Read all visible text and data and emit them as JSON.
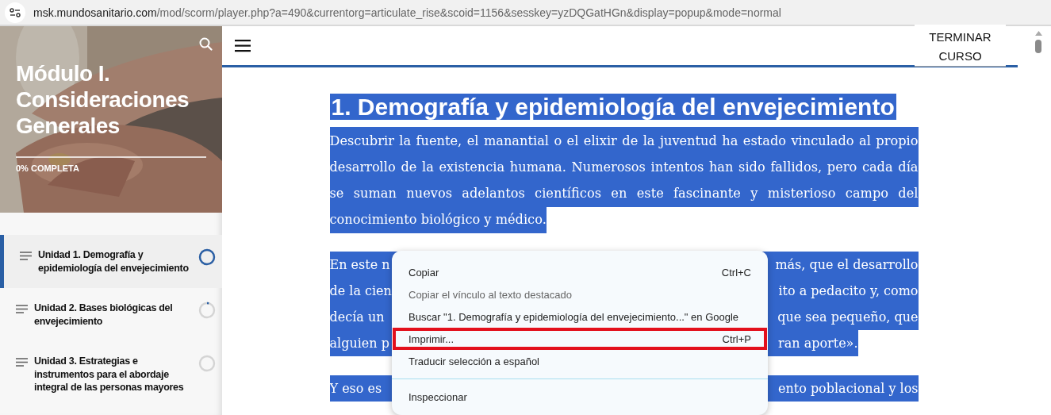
{
  "address_bar": {
    "domain": "msk.mundosanitario.com",
    "path": "/mod/scorm/player.php?a=490&currentorg=articulate_rise&scoid=1156&sesskey=yzDQGatHGn&display=popup&mode=normal"
  },
  "sidebar": {
    "title": "Módulo I. Consideraciones Generales",
    "progress": {
      "label": "0% COMPLETA",
      "level": 0
    },
    "items": [
      {
        "label": "Unidad 1. Demografía y epidemiología del envejecimiento",
        "selected": true,
        "level": 1
      },
      {
        "label": "Unidad 2. Bases biológicas del envejecimiento",
        "selected": false,
        "level": 0.04
      },
      {
        "label": "Unidad 3. Estrategias e instrumentos para el abordaje integral de las personas mayores",
        "selected": false,
        "level": 0
      }
    ]
  },
  "header": {
    "button": "TERMINAR CURSO"
  },
  "lesson": {
    "heading": "1. Demografía y epidemiología del envejecimiento",
    "paragraphs": [
      {
        "kind": "full",
        "text": "Descubrir la fuente, el manantial o el elixir de la juventud ha estado vinculado al propio desarrollo de la existencia humana. Numerosos intentos han sido fallidos, pero cada día se suman nuevos adelantos científicos en este fascinante y misterioso campo del conocimiento biológico y médico."
      },
      {
        "kind": "covered",
        "lines": [
          {
            "left": "En este n",
            "right": "más, que el desarrollo"
          },
          {
            "left": "de la cien",
            "right": "ito a pedacito y, como"
          },
          {
            "left": "decía un",
            "right": "que sea pequeño, que"
          },
          {
            "left": "alguien p",
            "right": "ran aporte»."
          }
        ]
      },
      {
        "kind": "covered",
        "lines": [
          {
            "left": "Y eso es",
            "right": "ento poblacional y los"
          }
        ]
      }
    ]
  },
  "context_menu": {
    "items": [
      {
        "kind": "item",
        "label": "Copiar",
        "shortcut": "Ctrl+C",
        "disabled": false,
        "highlighted": false
      },
      {
        "kind": "item",
        "label": "Copiar el vínculo al texto destacado",
        "disabled": true,
        "highlighted": false
      },
      {
        "kind": "item",
        "label": "Buscar \"1. Demografía y epidemiología del envejecimiento...\" en Google",
        "disabled": false,
        "highlighted": false
      },
      {
        "kind": "item",
        "label": "Imprimir...",
        "shortcut": "Ctrl+P",
        "disabled": false,
        "highlighted": true
      },
      {
        "kind": "item",
        "label": "Traducir selección a español",
        "disabled": false,
        "highlighted": false
      },
      {
        "kind": "separator"
      },
      {
        "kind": "item",
        "label": "Inspeccionar",
        "disabled": false,
        "highlighted": false
      }
    ]
  }
}
